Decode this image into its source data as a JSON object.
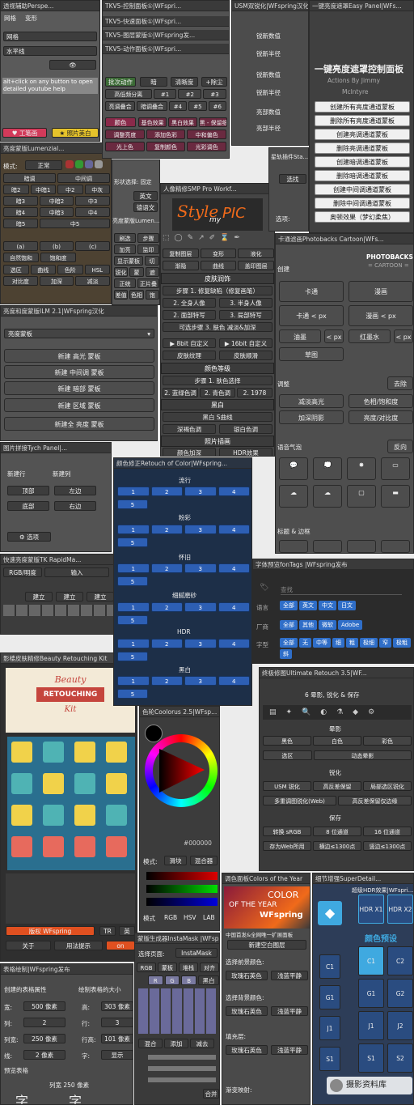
{
  "persp": {
    "title": "透视辅助Perspe...",
    "tab1": "网格",
    "tab2": "变形",
    "grid_label": "网格",
    "horizon_label": "水平线",
    "hint": "alt+click on any button to open detailed youtube help",
    "btn_workhorse": "工笔画",
    "btn_whiten": "照片美白"
  },
  "lum": {
    "title": "亮度蒙版Lumenzial...",
    "mode": "模式:",
    "normal": "正常",
    "rows": [
      [
        "暗调",
        "中间调"
      ],
      [
        "暗2",
        "中暗1",
        "中2",
        "中灰"
      ],
      [
        "暗3",
        "中暗2",
        "中3"
      ],
      [
        "暗4",
        "中暗3",
        "中4"
      ],
      [
        "暗5",
        "中5"
      ],
      [
        "(a)",
        "(b)",
        "(c)"
      ],
      [
        "自然饱和",
        "饱和度"
      ],
      [
        "选区",
        "曲线",
        "色阶",
        "HSL"
      ],
      [
        "对比度",
        "加深",
        "减淡"
      ]
    ]
  },
  "tk_ctrl": {
    "title": "TKV5-控制面板①|WFspri...",
    "title2": "TKV5-快速面板①|WFspri...",
    "title3": "TKV5-图层蒙版①|WFspring发...",
    "title4": "TKV5-动作面板①|WFspri...",
    "act": "批次动作",
    "b1": "暗",
    "b2": "清晰度",
    "b3": "+除尘",
    "r2": [
      "高低频分离",
      "#1",
      "#2",
      "#3"
    ],
    "r3": [
      "亮调叠合",
      "暗调叠合",
      "#4",
      "#5",
      "#6"
    ],
    "color": "颜色",
    "r5": [
      "基色效果",
      "黑白效果",
      "黑 - 保留细节"
    ],
    "r6": [
      "调整亮度",
      "添加色彩",
      "中和偏色"
    ],
    "r7": [
      "光上色",
      "复制颜色",
      "光彩调色"
    ]
  },
  "usm": {
    "title": "USM双锐化|WFspring汉化",
    "rows": [
      "锐新数值",
      "锐新半径",
      "锐新数值",
      "锐新半径",
      "亮部数值",
      "亮部半径"
    ]
  },
  "easy": {
    "title": "一键亮度遮罩Easy Panel|WFs...",
    "heading": "一键亮度遮罩控制面板",
    "sub1": "Actions By Jimmy",
    "sub2": "McIntyre",
    "buttons": [
      "创建所有亮度通道蒙板",
      "删除所有亮度通道蒙板",
      "创建亮调通道蒙板",
      "删除亮调通道蒙板",
      "创建暗调通道蒙板",
      "删除暗调通道蒙板",
      "创建中间调通道蒙板",
      "删除中间调通道蒙板",
      "奥顿效果（梦幻柔焦）"
    ]
  },
  "star": {
    "title": "星轨插件Sta...",
    "b1": "选找",
    "opt": "选项:"
  },
  "portrait": {
    "title": "人像精修SMP Pro Workf...",
    "logo1": "Style",
    "logo2": "my",
    "logo3": "PIC",
    "r1": [
      "复制图层",
      "变形",
      "液化"
    ],
    "r2": [
      "渐隐",
      "曲线",
      "盖印图层"
    ],
    "skin": "皮肤润饰",
    "steps": [
      "步骤 1. 修复缺陷（修复画笔）",
      "2. 全身人像",
      "3. 半身人像",
      "2. 面部特写",
      "3. 局部特写",
      "可选步骤 3. 肤色 减淡&加深",
      "▶ 8bit 自定义",
      "▶ 16bit 自定义",
      "皮肤纹理",
      "皮肤顺滑"
    ],
    "tone": "颜色等级",
    "tone_steps": [
      "步骤 1. 肤色选择",
      "2. 蓝绿色调",
      "2. 青色调",
      "2. 1978"
    ],
    "bw": "黑白",
    "bw_steps": [
      "黑白 S曲线",
      "深褐色调",
      "银白色调"
    ],
    "illus": "照片插画",
    "illus_steps": [
      "颜色加深",
      "HDR效果"
    ]
  },
  "lum2": {
    "title": "亮度蒙版Lumen...",
    "sel": "形状选择: 固定",
    "en": "英文",
    "de": "德语文",
    "rows": [
      [
        "刷选",
        "步骤"
      ],
      [
        "加亮",
        "监印"
      ],
      [
        "显示蒙板",
        "切"
      ],
      [
        "锐化",
        "蒙",
        "遮"
      ],
      [
        "正统",
        "正片叠"
      ],
      [
        "差值",
        "色相",
        "饱"
      ]
    ]
  },
  "ilm": {
    "title": "亮度和度蒙版ILM 2.1|WFspring汉化",
    "dropdown": "亮度蒙板",
    "buttons": [
      "新建 高光 蒙板",
      "新建 中间调 蒙板",
      "新建 暗部 蒙板",
      "新建 区域 蒙板",
      "新建全 亮度 蒙板"
    ]
  },
  "cartoon": {
    "title": "卡通滤画Photobacks Cartoon|WFs...",
    "brand": "PHOTOBACKS",
    "brand2": "= CARTOON =",
    "create": "创建",
    "cartoon": "卡通",
    "comic": "漫画",
    "cartoon_px": "卡通 < px",
    "comic_px": "漫画 < px",
    "oil": "油墨",
    "px": "< px",
    "redink": "红墨水",
    "sketch": "草图",
    "adjust": "调整",
    "remove": "去除",
    "r1": [
      "减淡高光",
      "色相/饱和度"
    ],
    "r2": [
      "加深阴影",
      "亮度/对比度"
    ],
    "speech": "语音气泡",
    "reverse": "反向",
    "titles": "标题 & 边框"
  },
  "tych": {
    "title": "图片拼接Tych Panel|...",
    "newrow": "新建行",
    "newcol": "新建列",
    "top": "顶部",
    "left": "左边",
    "bottom": "底部",
    "right": "右边",
    "opts": "选项"
  },
  "retouch": {
    "title": "颜色修正Retouch of Color|WFspring...",
    "sections": [
      "流行",
      "粉彩",
      "怀旧",
      "细腻磨砂",
      "HDR",
      "黑白"
    ],
    "nums": [
      "1",
      "2",
      "3",
      "4",
      "5"
    ]
  },
  "rapid": {
    "title": "快速亮度蒙版TK RapidMa...",
    "r1": [
      "RGB/明度",
      "输入"
    ],
    "r2": [
      "建立",
      "建立",
      "建立"
    ]
  },
  "fontags": {
    "title": "字体预览fonTags |WFspring发布",
    "search": "查找",
    "lang_label": "语言",
    "vendor_label": "厂商",
    "weight_label": "字型",
    "lang": [
      "全部",
      "英文",
      "中文",
      "日文"
    ],
    "vendor": [
      "全部",
      "其他",
      "微软",
      "Adobe"
    ],
    "weight": [
      "全部",
      "无",
      "中等",
      "细",
      "粗",
      "极细",
      "窄",
      "极粗",
      "斜"
    ]
  },
  "beauty": {
    "title": "影楼皮肤精修Beauty Retouching Kit",
    "l1": "Beauty",
    "l2": "RETOUCHING",
    "l3": "Kit",
    "footer": "版权 WFspring",
    "about": "关于",
    "usage": "用法提示",
    "tr": "TR",
    "en": "英",
    "on": "on"
  },
  "coolorus": {
    "title": "色轮Coolorus 2.5|WFsp...",
    "mode": "模式:",
    "slide": "滑块",
    "mix": "混合器",
    "hex": "#000000",
    "tabs": [
      "模式",
      "RGB",
      "HSV",
      "LAB"
    ]
  },
  "ultimate": {
    "title": "终极修图Ultimate Retouch 3.5|WF...",
    "heading": "6 晕影, 锐化 & 保存",
    "vig": "晕影",
    "r1": [
      "黑色",
      "白色",
      "彩色"
    ],
    "r2": [
      "选区",
      "动态晕影"
    ],
    "sharp": "锐化",
    "r3": [
      "USM 锐化",
      "高反差保留",
      "局部选区锐化"
    ],
    "r4": [
      "多重调图锐化(Web)",
      "高反差保留仅边缘"
    ],
    "save": "保存",
    "r5": [
      "转换 sRGB",
      "8 位通道",
      "16 位通道"
    ],
    "r6": [
      "存为Web所用",
      "横边≤1300点",
      "竖边≤1300点"
    ]
  },
  "table": {
    "title": "表格绘制|WFspring发布",
    "prop": "创建的表格属性",
    "draw": "绘制表格的大小",
    "w": "宽:",
    "w_v": "500 像素",
    "h": "高:",
    "h_v": "303 像素",
    "cols": "列:",
    "cols_v": "2",
    "rows": "行:",
    "rows_v": "3",
    "cw": "列宽:",
    "cw_v": "250 像素",
    "rh": "行高:",
    "rh_v": "101 像素",
    "line": "线:",
    "line_v": "2 像素",
    "font": "字:",
    "font_v": "显示",
    "preview": "预览表格",
    "cwide": "列宽 250 像素",
    "char": "字"
  },
  "insta": {
    "title": "蒙版生成器InstaMask |WFsp...",
    "page": "选择页面:",
    "mask": "InstaMask",
    "r1": [
      "RGB",
      "蒙板",
      "堆栈",
      "对齐"
    ],
    "rgb": [
      "R",
      "G",
      "B"
    ],
    "mix": "混合",
    "add": "添加",
    "sub": "减去",
    "fill": "合并",
    "black": "黑白"
  },
  "coty": {
    "title": "调色面板Colors of the Year",
    "c1": "COLOR",
    "c2": "OF THE YEAR",
    "c3": "WFspring",
    "c4": "中国首发&全网唯一扩展面板",
    "new_layer": "新建空白图层",
    "front": "选择前景颜色:",
    "pick": "玫瑰石英色",
    "pick2": "浅蓝平静",
    "back": "选择背景颜色:",
    "fillc": "填充层:",
    "grad": "渐变映射:"
  },
  "detail": {
    "title": "细节增强SuperDetail...",
    "hdr_title": "超级HDR效果|WFspri...",
    "hdr1": "HDR X1",
    "hdr2": "HDR X2",
    "preset": "颜色预设",
    "grid": [
      [
        "C1",
        "C2"
      ],
      [
        "G1",
        "G2"
      ],
      [
        "J1",
        "J2"
      ],
      [
        "S1",
        "S2"
      ]
    ]
  },
  "watermark": {
    "text": "摄影资料库"
  },
  "colors": {
    "blue": "#2d5fb4",
    "orange": "#f06a1a",
    "dark": "#535353"
  }
}
